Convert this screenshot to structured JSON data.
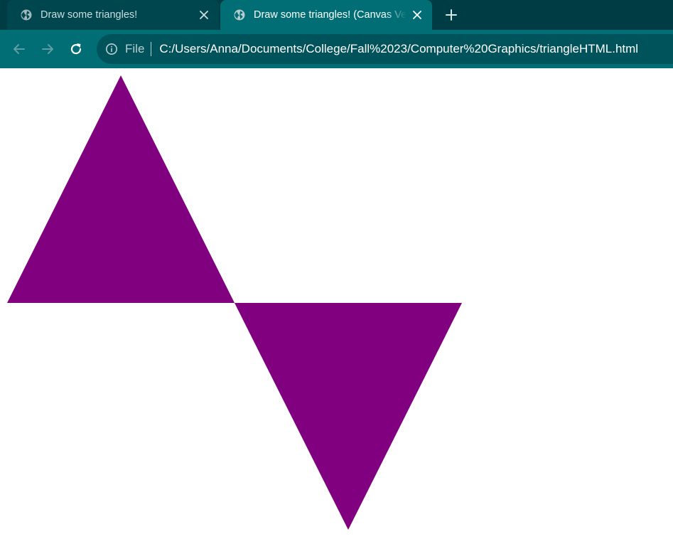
{
  "tabs": [
    {
      "title": "Draw some triangles!",
      "icon": "globe-icon",
      "active": false
    },
    {
      "title": "Draw some triangles! (Canvas Version)",
      "icon": "globe-icon",
      "active": true
    }
  ],
  "toolbar": {
    "scheme_label": "File",
    "url": "C:/Users/Anna/Documents/College/Fall%2023/Computer%20Graphics/triangleHTML.html",
    "icons": {
      "back": "arrow-left-icon",
      "forward": "arrow-right-icon",
      "reload": "reload-icon",
      "site_info": "info-icon",
      "new_tab": "plus-icon",
      "close_tab": "close-icon"
    }
  },
  "colors": {
    "tab_strip": "#003c43",
    "toolbar": "#006e74",
    "omnibox": "#00535a",
    "triangle_fill": "#800080",
    "page_background": "#ffffff"
  },
  "canvas": {
    "shapes": [
      {
        "kind": "triangle",
        "orientation": "pointing-up",
        "fill": "#800080"
      },
      {
        "kind": "triangle",
        "orientation": "pointing-down",
        "fill": "#800080"
      }
    ]
  }
}
